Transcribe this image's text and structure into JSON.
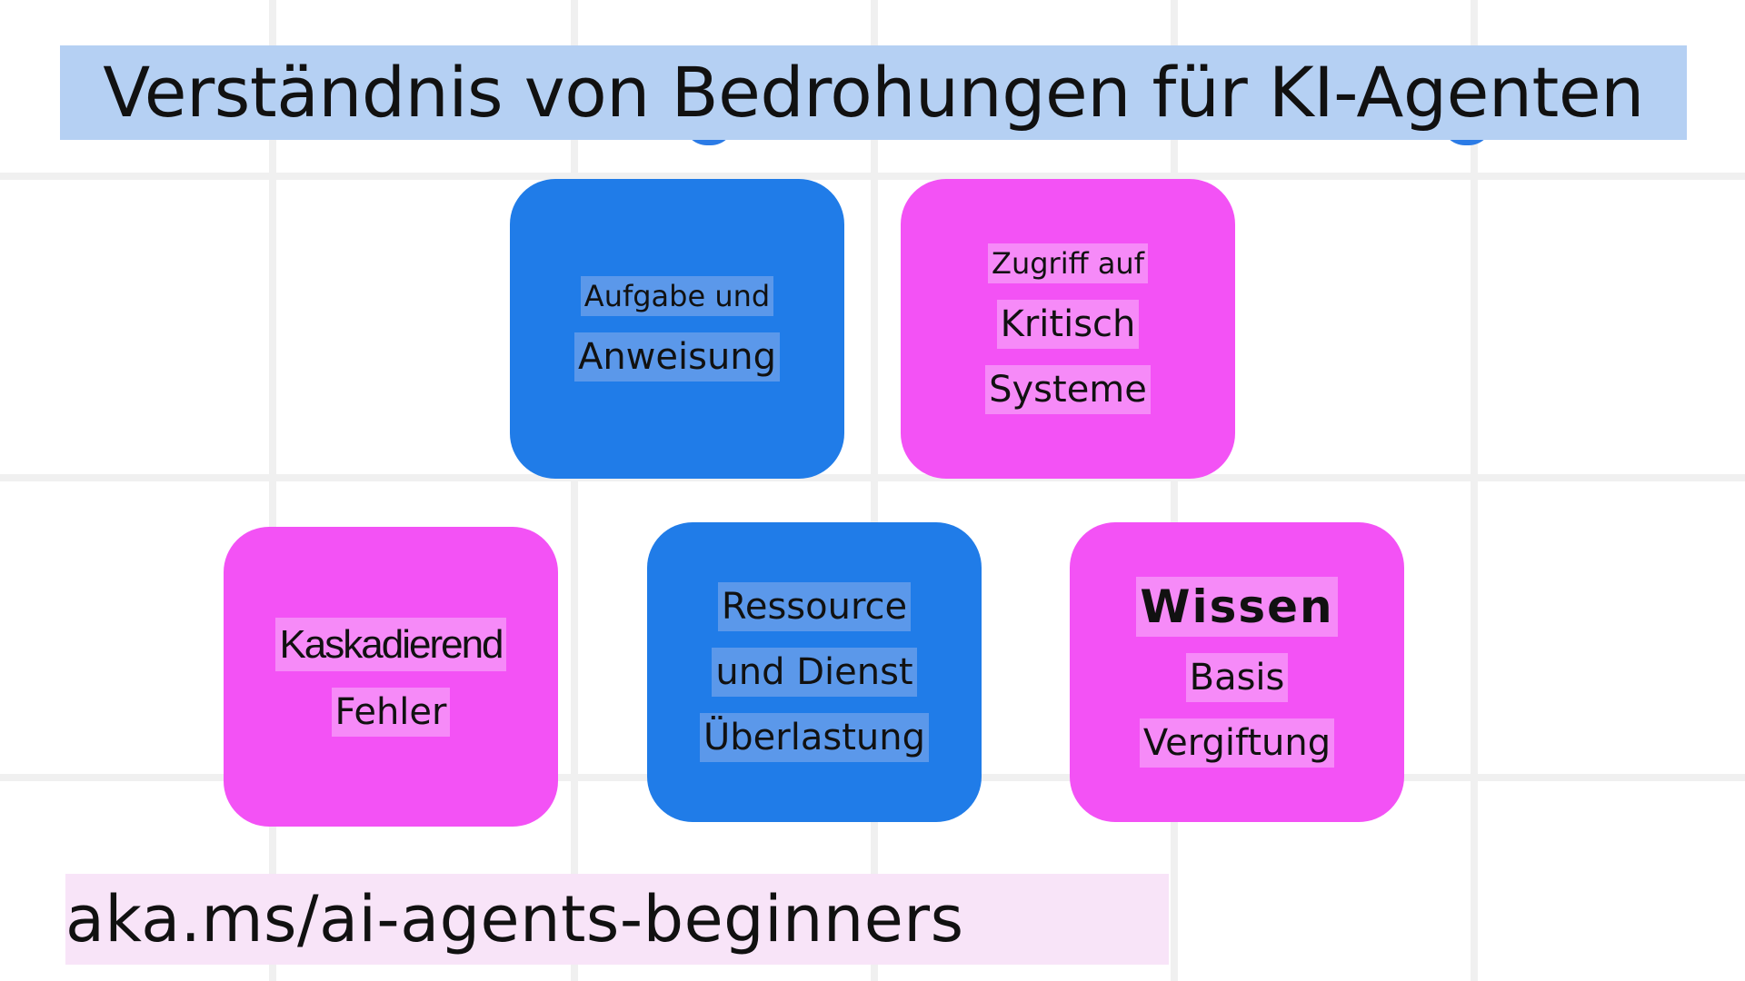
{
  "title": "Verständnis von Bedrohungen für KI-Agenten",
  "colors": {
    "blue_card": "#207ce8",
    "pink_card": "#f352f5",
    "title_highlight": "#b5d0f3",
    "url_highlight": "#f8e4f8"
  },
  "cards": [
    {
      "color": "blue",
      "lines": [
        "Aufgabe und",
        "Anweisung"
      ]
    },
    {
      "color": "pink",
      "lines": [
        "Zugriff auf",
        "Kritisch",
        "Systeme"
      ]
    },
    {
      "color": "pink",
      "lines": [
        "Kaskadierend",
        "Fehler"
      ]
    },
    {
      "color": "blue",
      "lines": [
        "Ressource",
        "und Dienst",
        "Überlastung"
      ]
    },
    {
      "color": "pink",
      "lines": [
        "Wissen",
        "Basis",
        "Vergiftung"
      ]
    }
  ],
  "footer_link": "aka.ms/ai-agents-beginners"
}
